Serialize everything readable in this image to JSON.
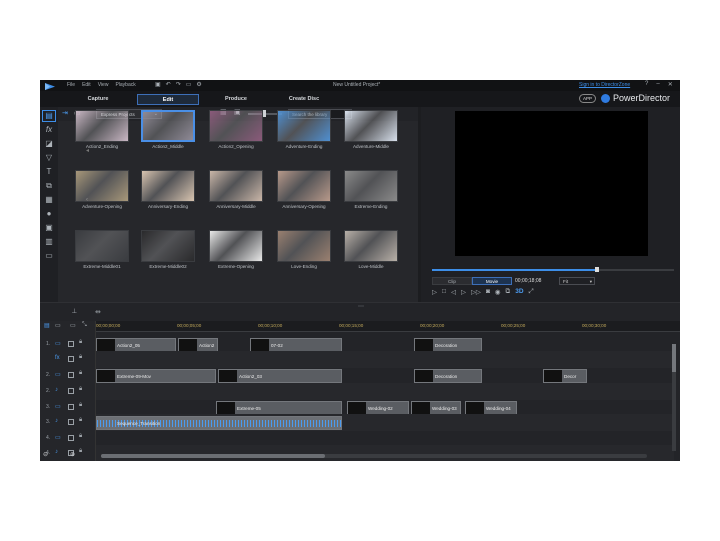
{
  "titlebar": {
    "menu": [
      "File",
      "Edit",
      "View",
      "Playback"
    ],
    "doc_title": "New Untitled Project*",
    "signin": "Sign in to DirectorZone",
    "help": "?",
    "minimize": "–",
    "close": "✕"
  },
  "modes": {
    "tabs": [
      "Capture",
      "Edit",
      "Produce",
      "Create Disc"
    ],
    "active": "Edit",
    "app_badge": "APP",
    "brand": "PowerDirector"
  },
  "library": {
    "dropdown": "Express Projects",
    "search_placeholder": "Search the library",
    "thumbnails": [
      {
        "label": "Action2_Ending",
        "bg": "#c9b7c4"
      },
      {
        "label": "Action2_Middle",
        "bg": "#8f8a96"
      },
      {
        "label": "Action2_Opening",
        "bg": "#8a5a7a"
      },
      {
        "label": "Adventure-Ending",
        "bg": "#4f8fd0"
      },
      {
        "label": "Adventure-Middle",
        "bg": "#d8e0ec"
      },
      {
        "label": "Adventure-Opening",
        "bg": "#a8987a"
      },
      {
        "label": "Anniversary-Ending",
        "bg": "#d8c4b0"
      },
      {
        "label": "Anniversary-Middle",
        "bg": "#c9b6a8"
      },
      {
        "label": "Anniversary-Opening",
        "bg": "#b7998a"
      },
      {
        "label": "Extreme-Ending",
        "bg": "#8a8a8a"
      },
      {
        "label": "Extreme-Middle01",
        "bg": "#3a3c40"
      },
      {
        "label": "Extreme-Middle02",
        "bg": "#2a2a2c"
      },
      {
        "label": "Extreme-Opening",
        "bg": "#e8e8e8"
      },
      {
        "label": "Love-Ending",
        "bg": "#9a8070"
      },
      {
        "label": "Love-Middle",
        "bg": "#b8b0a8"
      }
    ]
  },
  "preview": {
    "tab_clip": "Clip",
    "tab_movie": "Movie",
    "timecode": "00;00;18;08",
    "fit": "Fit",
    "seek_fraction": 0.68
  },
  "timeline": {
    "ruler": [
      "00;00;00;00",
      "00;00;05;00",
      "00;00;10;00",
      "00;00;15;00",
      "00;00;20;00",
      "00;00;25;00",
      "00;00;30;00"
    ],
    "tracks": [
      {
        "num": "1.",
        "icon": "video"
      },
      {
        "num": "",
        "icon": "fx"
      },
      {
        "num": "2.",
        "icon": "video"
      },
      {
        "num": "2.",
        "icon": "audio"
      },
      {
        "num": "3.",
        "icon": "video"
      },
      {
        "num": "3.",
        "icon": "audio"
      },
      {
        "num": "4.",
        "icon": "video"
      },
      {
        "num": "4.",
        "icon": "audio"
      },
      {
        "num": "",
        "icon": "title"
      }
    ],
    "clips": {
      "c1": "Action2_05",
      "c2": "Action2",
      "c3": "07-02",
      "c4": "Decoration",
      "c5": "Extreme-09-Mov",
      "c6": "Action2_03",
      "c7": "Decoration",
      "c8": "Decor",
      "c9": "Extreme-05",
      "c10": "Sequence_Transition",
      "c11": "Wedding-02",
      "c12": "Wedding-03",
      "c13": "Wedding-04"
    }
  }
}
